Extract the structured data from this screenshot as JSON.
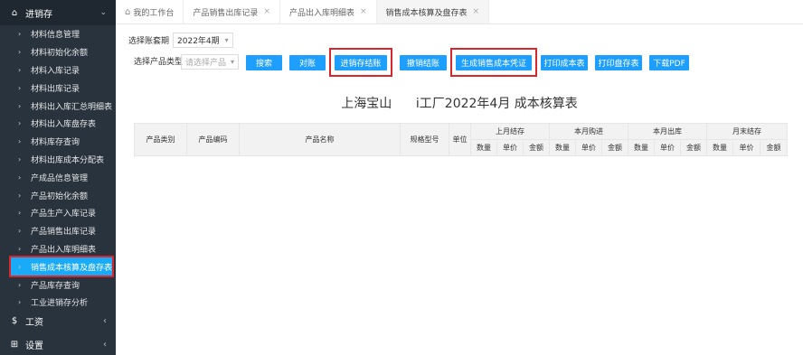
{
  "sidebar": {
    "section_title": "进销存",
    "items": [
      {
        "label": "材料信息管理"
      },
      {
        "label": "材料初始化余额"
      },
      {
        "label": "材料入库记录"
      },
      {
        "label": "材料出库记录"
      },
      {
        "label": "材料出入库汇总明细表"
      },
      {
        "label": "材料出入库盘存表"
      },
      {
        "label": "材料库存查询"
      },
      {
        "label": "材料出库成本分配表"
      },
      {
        "label": "产成品信息管理"
      },
      {
        "label": "产品初始化余额"
      },
      {
        "label": "产品生产入库记录"
      },
      {
        "label": "产品销售出库记录"
      },
      {
        "label": "产品出入库明细表"
      },
      {
        "label": "销售成本核算及盘存表"
      },
      {
        "label": "产品库存查询"
      },
      {
        "label": "工业进销存分析"
      }
    ],
    "active_index": 13,
    "footer": [
      {
        "label": "工资",
        "icon": "dollar-icon"
      },
      {
        "label": "设置",
        "icon": "grid-icon"
      }
    ]
  },
  "tabs": [
    {
      "label": "我的工作台"
    },
    {
      "label": "产品销售出库记录"
    },
    {
      "label": "产品出入库明细表"
    },
    {
      "label": "销售成本核算及盘存表"
    }
  ],
  "toolbar": {
    "period_label": "选择账套期",
    "period_value": "2022年4期",
    "product_type_label": "选择产品类型",
    "product_placeholder": "请选择产品",
    "buttons": {
      "search": "搜索",
      "reconcile": "对账",
      "close_inventory": "进销存结账",
      "undo_close": "撤销结账",
      "gen_voucher": "生成销售成本凭证",
      "print_cost": "打印成本表",
      "print_inventory": "打印盘存表",
      "download_pdf": "下载PDF"
    }
  },
  "report_title": "上海宝山      i工厂2022年4月 成本核算表",
  "table": {
    "headers": {
      "category": "产品类别",
      "code": "产品编码",
      "name": "产品名称",
      "spec": "规格型号",
      "unit": "单位",
      "last_month": "上月结存",
      "purchase": "本月购进",
      "outbound": "本月出库",
      "month_end": "月末结存"
    },
    "sub_headers": [
      "数量",
      "单价",
      "金额"
    ]
  },
  "colors": {
    "accent": "#1e9fff",
    "sidebar_bg": "#28333e",
    "active_item": "#19aaf8",
    "highlight": "#d9262c"
  }
}
